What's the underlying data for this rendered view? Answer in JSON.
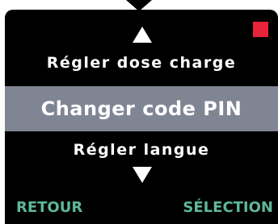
{
  "colors": {
    "screen_background": "#000000",
    "text": "#ffffff",
    "selection_highlight": "#808594",
    "status_indicator": "#e8243a",
    "softkey_text": "#5fb89a"
  },
  "icons": {
    "scroll_up": "triangle-up-icon",
    "scroll_down": "triangle-down-icon",
    "status": "red-square-icon"
  },
  "menu": {
    "previous_item": "Régler dose charge",
    "selected_item": "Changer code PIN",
    "next_item": "Régler langue"
  },
  "softkeys": {
    "left_label": "RETOUR",
    "right_label": "SÉLECTION"
  }
}
